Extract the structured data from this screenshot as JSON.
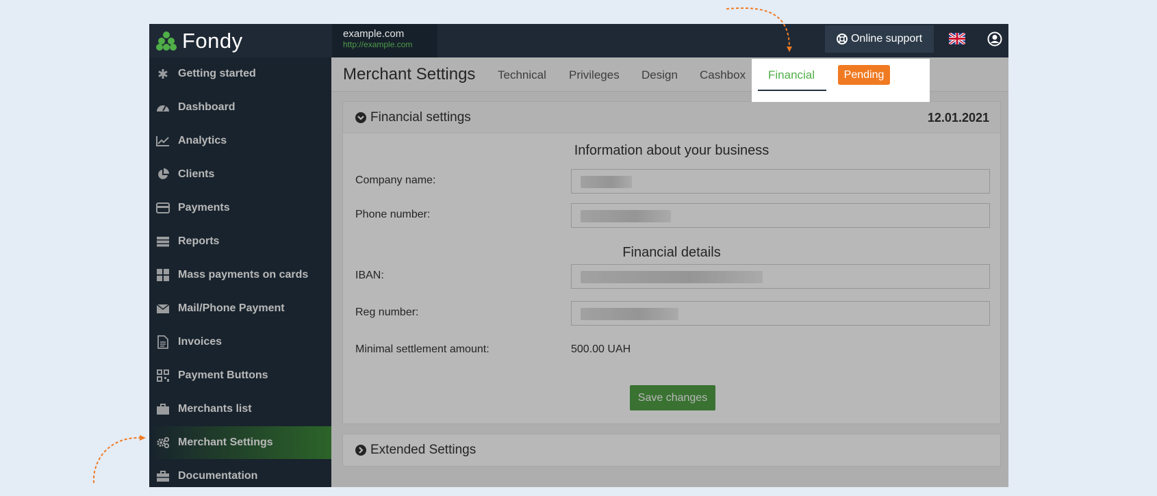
{
  "brand": {
    "name": "Fondy",
    "logo_color": "#4fae47"
  },
  "site": {
    "name": "example.com",
    "url": "http://example.com"
  },
  "header": {
    "support_label": "Online support",
    "language": "flag-uk-icon",
    "user": "user-icon"
  },
  "sidebar": {
    "items": [
      {
        "label": "Getting started",
        "icon": "asterisk-icon"
      },
      {
        "label": "Dashboard",
        "icon": "speedometer-icon"
      },
      {
        "label": "Analytics",
        "icon": "line-chart-icon"
      },
      {
        "label": "Clients",
        "icon": "pie-chart-icon"
      },
      {
        "label": "Payments",
        "icon": "credit-card-icon"
      },
      {
        "label": "Reports",
        "icon": "server-icon"
      },
      {
        "label": "Mass payments on cards",
        "icon": "grid-icon"
      },
      {
        "label": "Mail/Phone Payment",
        "icon": "envelope-icon"
      },
      {
        "label": "Invoices",
        "icon": "document-icon"
      },
      {
        "label": "Payment Buttons",
        "icon": "qr-code-icon"
      },
      {
        "label": "Merchants list",
        "icon": "briefcase-icon"
      },
      {
        "label": "Merchant Settings",
        "icon": "gears-icon",
        "active": true
      },
      {
        "label": "Documentation",
        "icon": "toolbox-icon"
      }
    ]
  },
  "main": {
    "title": "Merchant Settings",
    "tabs": [
      "Technical",
      "Privileges",
      "Design",
      "Cashbox",
      "Financial"
    ],
    "active_tab": "Financial",
    "status_badge": "Pending",
    "status_color": "#f07a22",
    "financial_panel": {
      "title": "Financial settings",
      "date": "12.01.2021",
      "business_section": "Information about your business",
      "company_label": "Company name:",
      "phone_label": "Phone number:",
      "details_section": "Financial details",
      "iban_label": "IBAN:",
      "reg_label": "Reg number:",
      "min_amount_label": "Minimal settlement amount:",
      "min_amount_value": "500.00 UAH",
      "save_label": "Save changes"
    },
    "extended_panel": {
      "title": "Extended Settings"
    }
  },
  "colors": {
    "sidebar": "#22313f",
    "accent": "#4fae47",
    "annotation": "#f07a22"
  }
}
